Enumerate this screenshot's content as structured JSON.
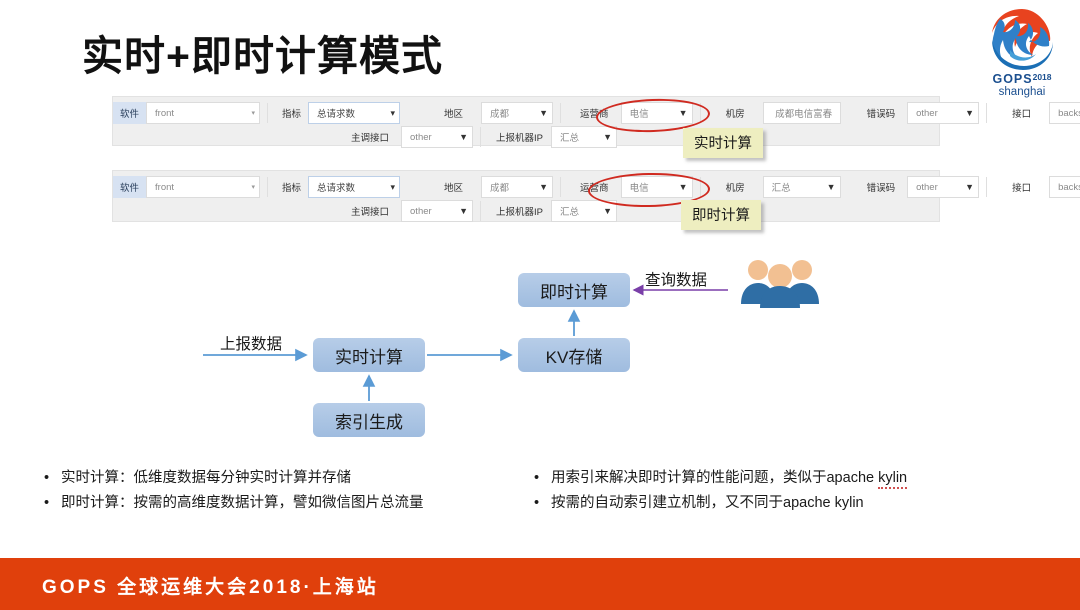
{
  "slide": {
    "title": "实时+即时计算模式"
  },
  "logo": {
    "name": "GOPS",
    "year": "2018",
    "city": "shanghai"
  },
  "toolbars": [
    {
      "id": "realtime",
      "callout": "实时计算",
      "row1": [
        {
          "label": "软件",
          "value": "front",
          "caret": "▾",
          "style": "highlight-label"
        },
        {
          "label": "指标",
          "value": "总请求数",
          "caret": "▾",
          "style": "boxed"
        },
        {
          "label": "地区",
          "value": "成都",
          "caret": "▼",
          "style": "plain"
        },
        {
          "label": "运营商",
          "value": "电信",
          "caret": "▼",
          "style": "plain"
        },
        {
          "label": "机房",
          "value": "成都电信富春",
          "caret": "",
          "style": "plain"
        },
        {
          "label": "错误码",
          "value": "other",
          "caret": "▼",
          "style": "plain"
        },
        {
          "label": "接口",
          "value": "backsrcz",
          "caret": "▼",
          "style": "plain"
        }
      ],
      "row2": [
        {
          "label": "主调接口",
          "value": "other",
          "caret": "▼"
        },
        {
          "label": "上报机器IP",
          "value": "汇总",
          "caret": "▼"
        }
      ]
    },
    {
      "id": "instant",
      "callout": "即时计算",
      "row1": [
        {
          "label": "软件",
          "value": "front",
          "caret": "▾",
          "style": "highlight-label"
        },
        {
          "label": "指标",
          "value": "总请求数",
          "caret": "▾",
          "style": "boxed"
        },
        {
          "label": "地区",
          "value": "成都",
          "caret": "▼",
          "style": "plain"
        },
        {
          "label": "运营商",
          "value": "电信",
          "caret": "▼",
          "style": "plain"
        },
        {
          "label": "机房",
          "value": "汇总",
          "caret": "▼",
          "style": "plain"
        },
        {
          "label": "错误码",
          "value": "other",
          "caret": "▼",
          "style": "plain"
        },
        {
          "label": "接口",
          "value": "backsrcz",
          "caret": "▼",
          "style": "plain"
        }
      ],
      "row2": [
        {
          "label": "主调接口",
          "value": "other",
          "caret": "▼"
        },
        {
          "label": "上报机器IP",
          "value": "汇总",
          "caret": "▼"
        }
      ]
    }
  ],
  "diagram": {
    "nodes": {
      "realtime": "实时计算",
      "kv": "KV存储",
      "instant": "即时计算",
      "index": "索引生成"
    },
    "labels": {
      "report": "上报数据",
      "query": "查询数据"
    }
  },
  "bullets": {
    "left": [
      "实时计算：低维度数据每分钟实时计算并存储",
      "即时计算：按需的高维度数据计算，譬如微信图片总流量"
    ],
    "right_1_a": "用索引来解决即时计算的性能问题，类似于apache ",
    "right_1_b": "kylin",
    "right_2": "按需的自动索引建立机制，又不同于apache kylin",
    "marker": "•"
  },
  "footer": {
    "text": "GOPS 全球运维大会2018·上海站"
  },
  "colors": {
    "footer_bg": "#e0400c",
    "node_fill": "#9fbcdf",
    "callout_bg": "#eeeec0",
    "annotation_red": "#d02a20",
    "query_arrow": "#7a3fa8",
    "flow_arrow": "#5b9bd5"
  }
}
